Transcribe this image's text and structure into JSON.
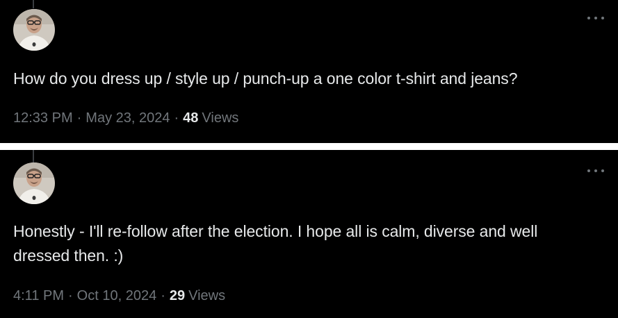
{
  "tweets": [
    {
      "text": "How do you dress up / style up / punch-up a one color t-shirt and jeans?",
      "time": "12:33 PM",
      "date": "May 23, 2024",
      "views_count": "48",
      "views_label": "Views"
    },
    {
      "text": "Honestly - I'll re-follow after the election. I hope all is calm, diverse and well dressed then. :)",
      "time": "4:11 PM",
      "date": "Oct 10, 2024",
      "views_count": "29",
      "views_label": "Views"
    }
  ],
  "separator": "·",
  "colors": {
    "background": "#000000",
    "divider": "#ffffff",
    "text": "#e7e9ea",
    "muted": "#71767b"
  },
  "icons": {
    "more": "more-horizontal-icon",
    "avatar": "avatar"
  }
}
